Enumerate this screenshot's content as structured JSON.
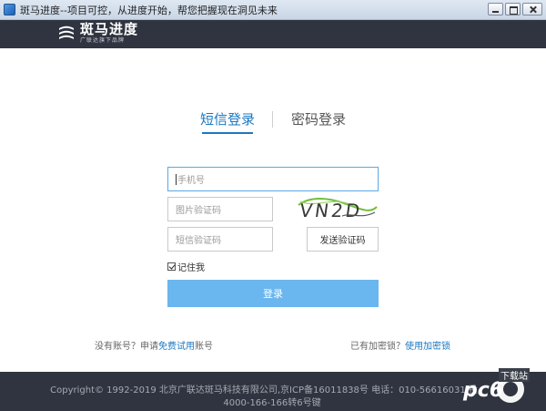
{
  "window": {
    "title": "斑马进度--项目可控，从进度开始，帮您把握现在洞见未来"
  },
  "header": {
    "logo_name": "斑马进度",
    "logo_slogan": "广联达旗下品牌"
  },
  "tabs": {
    "sms_login": "短信登录",
    "password_login": "密码登录"
  },
  "form": {
    "phone_placeholder": "手机号",
    "image_code_placeholder": "图片验证码",
    "sms_code_placeholder": "短信验证码",
    "captcha_text": "VN2D",
    "send_code_label": "发送验证码",
    "remember_label": "记住我",
    "remember_checked": true,
    "login_label": "登录"
  },
  "links": {
    "no_account_prefix": "没有账号？申请",
    "free_trial": "免费试用",
    "no_account_suffix": "账号",
    "has_lock_prefix": "已有加密锁？",
    "use_lock": "使用加密锁"
  },
  "footer": {
    "line1": "Copyright© 1992-2019 北京广联达斑马科技有限公司,京ICP备16011838号 电话：010-56616031 投",
    "line2": "4000-166-166转6号键"
  },
  "watermark": {
    "site": "pc6",
    "label": "下载站"
  },
  "colors": {
    "accent": "#1a78c2",
    "login_button": "#6ab6ef",
    "header_bg": "#2f3440"
  }
}
